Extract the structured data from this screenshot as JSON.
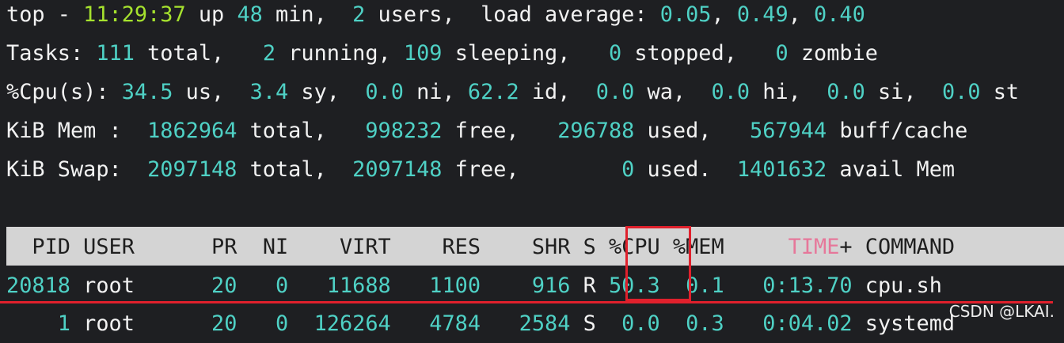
{
  "summary": {
    "line1": {
      "prefix": "top - ",
      "time": "11:29:37",
      "up_label": " up ",
      "up_min": "48",
      "min_label": " min,  ",
      "users": "2",
      "users_label": " users,  load average: ",
      "load1": "0.05",
      "sep1": ", ",
      "load5": "0.49",
      "sep2": ", ",
      "load15": "0.40"
    },
    "line2": {
      "label": "Tasks: ",
      "total": "111",
      "total_label": " total,   ",
      "running": "2",
      "running_label": " running, ",
      "sleeping": "109",
      "sleeping_label": " sleeping,   ",
      "stopped": "0",
      "stopped_label": " stopped,   ",
      "zombie": "0",
      "zombie_label": " zombie"
    },
    "line3": {
      "label": "%Cpu(s): ",
      "us": "34.5",
      "us_label": " us,  ",
      "sy": "3.4",
      "sy_label": " sy,  ",
      "ni": "0.0",
      "ni_label": " ni, ",
      "id": "62.2",
      "id_label": " id,  ",
      "wa": "0.0",
      "wa_label": " wa,  ",
      "hi": "0.0",
      "hi_label": " hi,  ",
      "si": "0.0",
      "si_label": " si,  ",
      "st": "0.0",
      "st_label": " st"
    },
    "line4": {
      "label": "KiB Mem :  ",
      "total": "1862964",
      "total_label": " total,   ",
      "free": "998232",
      "free_label": " free,   ",
      "used": "296788",
      "used_label": " used,   ",
      "buff": "567944",
      "buff_label": " buff/cache"
    },
    "line5": {
      "label": "KiB Swap:  ",
      "total": "2097148",
      "total_label": " total,  ",
      "free": "2097148",
      "free_label": " free,        ",
      "used": "0",
      "used_label": " used.  ",
      "avail": "1401632",
      "avail_label": " avail Mem"
    }
  },
  "table": {
    "header": {
      "pid": "  PID",
      "user": " USER     ",
      "pr": " PR",
      "ni": "  NI",
      "virt": "    VIRT",
      "res": "    RES",
      "shr": "    SHR",
      "s": " S",
      "cpu": " %CPU",
      "mem": " %MEM",
      "time_pad": "     ",
      "time": "TIME",
      "time_plus": "+",
      "command": " COMMAND"
    },
    "rows": [
      {
        "pid": "20818",
        "user": " root     ",
        "pr": " 20",
        "ni": "   0",
        "virt": "   11688",
        "res": "   1100",
        "shr": "    916",
        "s": " R",
        "cpu": " 50.3",
        "mem": "  0.1",
        "time": "   0:13.70",
        "command": " cpu.sh"
      },
      {
        "pid": "    1",
        "user": " root     ",
        "pr": " 20",
        "ni": "   0",
        "virt": "  126264",
        "res": "   4784",
        "shr": "   2584",
        "s": " S",
        "cpu": "  0.0",
        "mem": "  0.3",
        "time": "   0:04.02",
        "command": " systemd"
      }
    ]
  },
  "watermark": "CSDN @LKAI."
}
